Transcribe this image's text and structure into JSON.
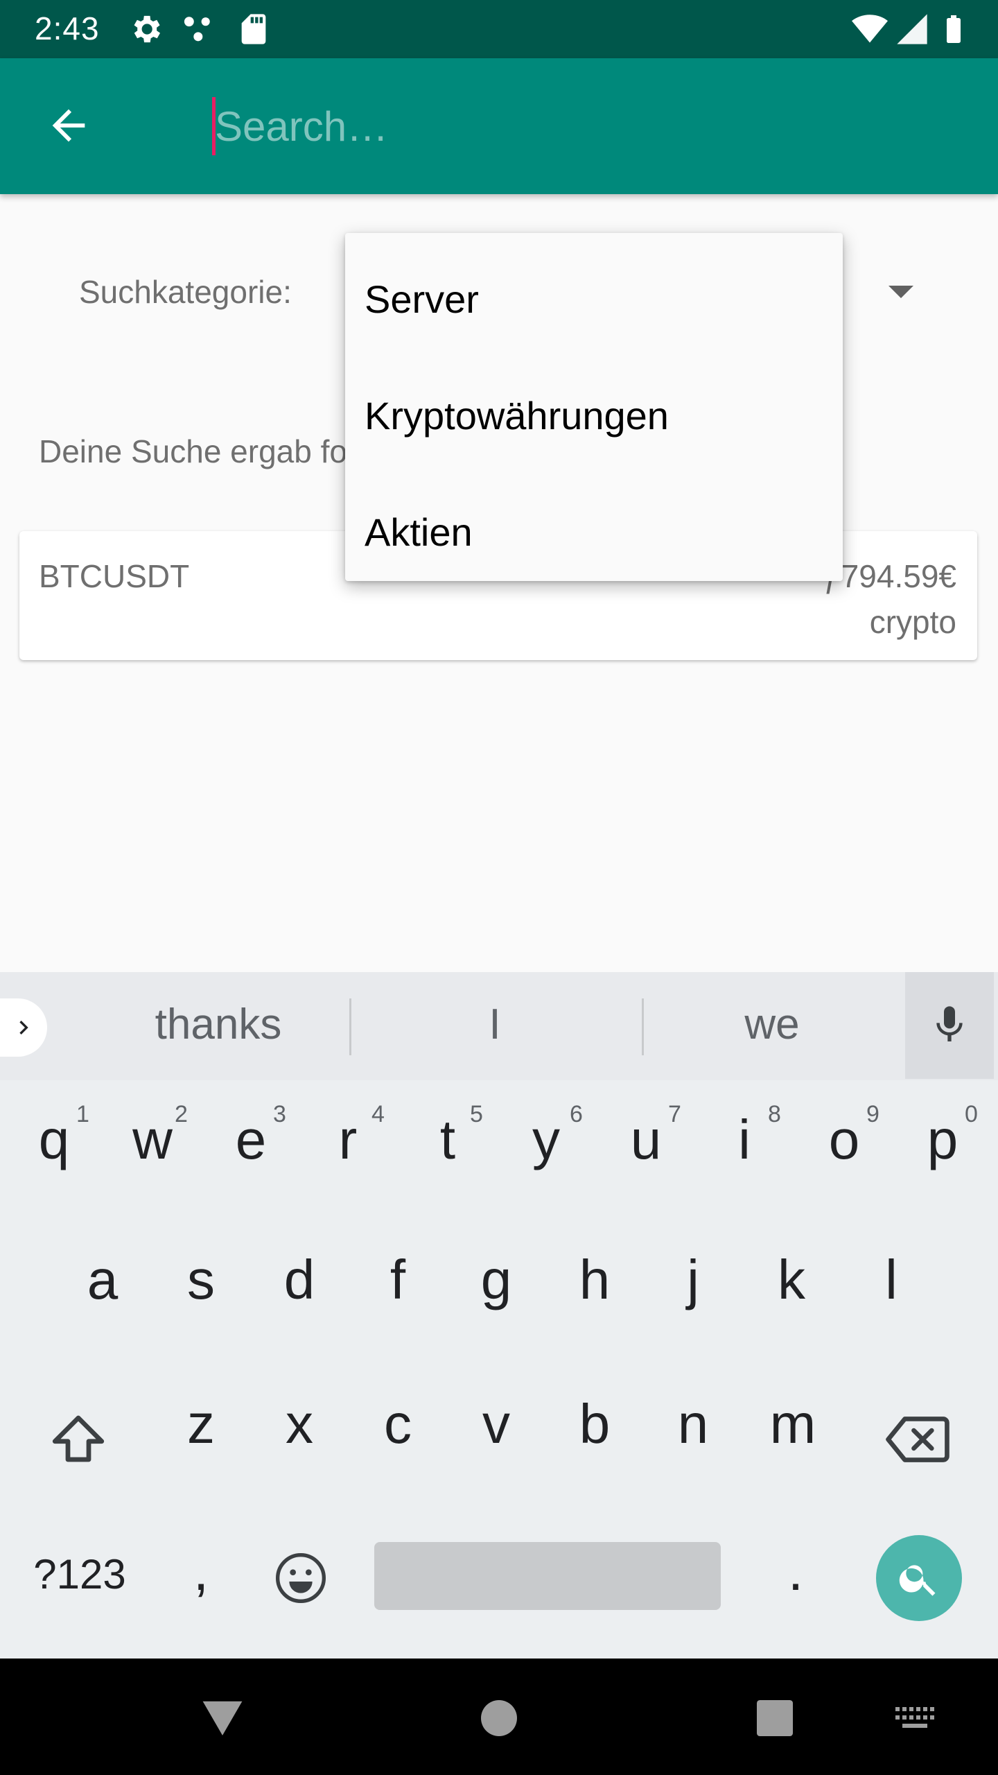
{
  "status_bar": {
    "time": "2:43"
  },
  "toolbar": {
    "search_placeholder": "Search…"
  },
  "filter": {
    "category_label": "Suchkategorie:"
  },
  "dropdown": {
    "options": [
      "Server",
      "Kryptowährungen",
      "Aktien"
    ]
  },
  "results": {
    "summary_visible": "Deine Suche ergab fo",
    "items": [
      {
        "symbol": "BTCUSDT",
        "price_visible": "ƒ794.59€",
        "type": "crypto"
      }
    ]
  },
  "keyboard": {
    "suggestions": [
      "thanks",
      "I",
      "we"
    ],
    "row1": [
      "q",
      "w",
      "e",
      "r",
      "t",
      "y",
      "u",
      "i",
      "o",
      "p"
    ],
    "row1_numbers": [
      "1",
      "2",
      "3",
      "4",
      "5",
      "6",
      "7",
      "8",
      "9",
      "0"
    ],
    "row2": [
      "a",
      "s",
      "d",
      "f",
      "g",
      "h",
      "j",
      "k",
      "l"
    ],
    "row3": [
      "z",
      "x",
      "c",
      "v",
      "b",
      "n",
      "m"
    ],
    "symbols_key": "?123",
    "comma_key": ",",
    "period_key": "."
  },
  "colors": {
    "toolbar": "#00897b",
    "status_bar": "#00574b",
    "accent": "#e91e63",
    "search_key": "#4db6ac"
  },
  "icons": [
    "settings-icon",
    "dots-icon",
    "sd-card-icon",
    "wifi-icon",
    "signal-icon",
    "battery-icon",
    "back-arrow-icon",
    "dropdown-arrow-icon",
    "mic-icon",
    "shift-icon",
    "backspace-icon",
    "emoji-icon",
    "search-icon",
    "nav-back-icon",
    "nav-home-icon",
    "nav-recents-icon",
    "keyboard-icon"
  ]
}
